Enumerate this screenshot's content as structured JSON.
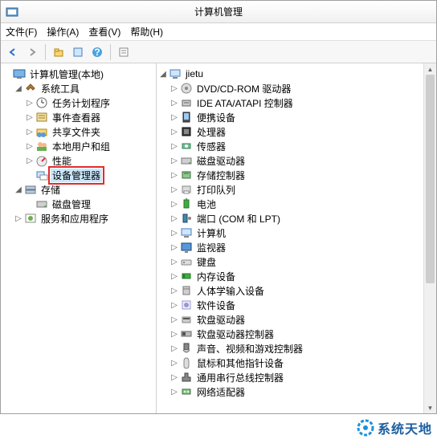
{
  "title": "计算机管理",
  "menu": {
    "file": "文件(F)",
    "action": "操作(A)",
    "view": "查看(V)",
    "help": "帮助(H)"
  },
  "left": {
    "root": "计算机管理(本地)",
    "systools": "系统工具",
    "task": "任务计划程序",
    "event": "事件查看器",
    "shared": "共享文件夹",
    "users": "本地用户和组",
    "perf": "性能",
    "devmgr": "设备管理器",
    "storage": "存储",
    "diskmgmt": "磁盘管理",
    "services": "服务和应用程序"
  },
  "right": {
    "root": "jietu",
    "items": [
      "DVD/CD-ROM 驱动器",
      "IDE ATA/ATAPI 控制器",
      "便携设备",
      "处理器",
      "传感器",
      "磁盘驱动器",
      "存储控制器",
      "打印队列",
      "电池",
      "端口 (COM 和 LPT)",
      "计算机",
      "监视器",
      "键盘",
      "内存设备",
      "人体学输入设备",
      "软件设备",
      "软盘驱动器",
      "软盘驱动器控制器",
      "声音、视频和游戏控制器",
      "鼠标和其他指针设备",
      "通用串行总线控制器",
      "网络适配器"
    ]
  },
  "brand": "系统天地"
}
